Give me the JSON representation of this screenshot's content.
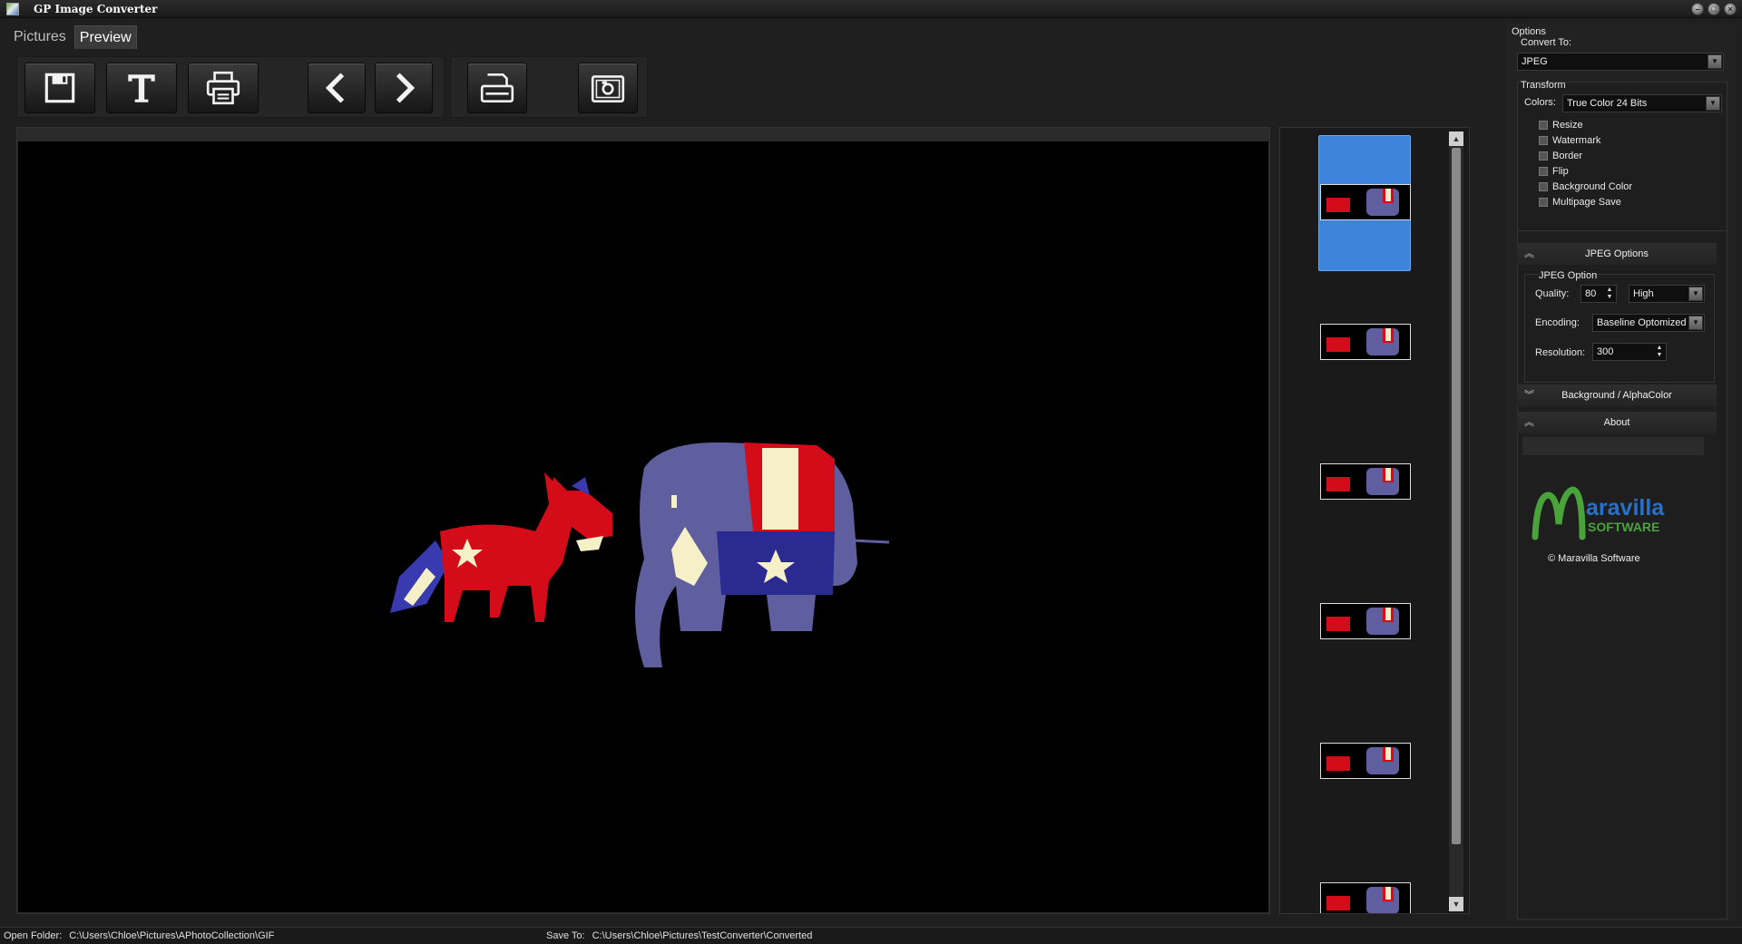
{
  "window": {
    "title": "GP Image Converter"
  },
  "tabs": [
    {
      "label": "Pictures"
    },
    {
      "label": "Preview"
    }
  ],
  "toolbar": {
    "buttons": [
      {
        "icon": "save-icon"
      },
      {
        "icon": "text-icon"
      },
      {
        "icon": "print-icon"
      },
      {
        "icon": "previous-icon"
      },
      {
        "icon": "next-icon"
      },
      {
        "icon": "scanner-icon"
      },
      {
        "icon": "screenshot-icon"
      }
    ]
  },
  "thumbnails": {
    "count": 6,
    "selected_index": 0
  },
  "options": {
    "title": "Options",
    "convert_to_label": "Convert To:",
    "convert_to_value": "JPEG",
    "transform_label": "Transform",
    "colors_label": "Colors:",
    "colors_value": "True Color 24 Bits",
    "checkboxes": [
      {
        "label": "Resize",
        "checked": false
      },
      {
        "label": "Watermark",
        "checked": false
      },
      {
        "label": "Border",
        "checked": false
      },
      {
        "label": "Flip",
        "checked": false
      },
      {
        "label": "Background Color",
        "checked": false
      },
      {
        "label": "Multipage Save",
        "checked": false
      }
    ],
    "jpeg_options": {
      "header": "JPEG Options",
      "group_label": "JPEG Option",
      "quality_label": "Quality:",
      "quality_value": "80",
      "quality_preset": "High",
      "encoding_label": "Encoding:",
      "encoding_value": "Baseline Optomized",
      "resolution_label": "Resolution:",
      "resolution_value": "300"
    },
    "background_header": "Background / AlphaColor",
    "about_header": "About",
    "logo": {
      "line1": "aravilla",
      "line2": "SOFTWARE",
      "copyright": "© Maravilla Software"
    }
  },
  "statusbar": {
    "open_folder_label": "Open Folder:",
    "open_folder_value": "C:\\Users\\Chloe\\Pictures\\APhotoCollection\\GIF",
    "save_to_label": "Save To:",
    "save_to_value": "C:\\Users\\Chloe\\Pictures\\TestConverter\\Converted"
  },
  "colors": {
    "accent_selection": "#3d84dd",
    "background": "#1f1f1f",
    "preview_bg": "#000000",
    "donkey_red": "#d40c1a",
    "elephant_blue": "#5f5fa0",
    "logo_green": "#4aa33a",
    "logo_blue": "#2a6fc9"
  }
}
